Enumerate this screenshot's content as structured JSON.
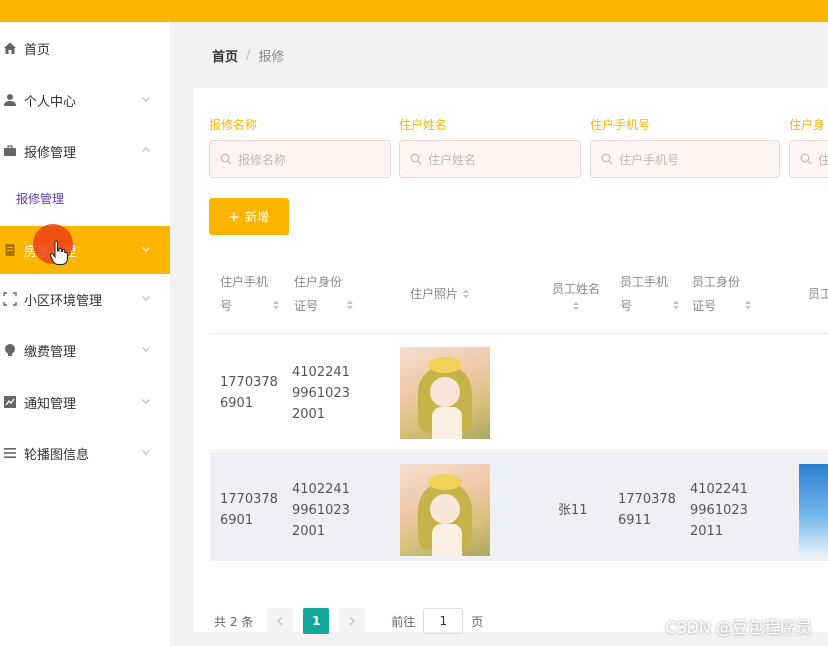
{
  "colors": {
    "accent": "#ffb400",
    "pager_active": "#13a89e",
    "submenu_text": "#5b3fa6"
  },
  "sidebar": {
    "items": [
      {
        "label": "首页",
        "icon": "home-icon"
      },
      {
        "label": "个人中心",
        "icon": "user-icon"
      },
      {
        "label": "报修管理",
        "icon": "briefcase-icon"
      },
      {
        "label": "房屋管理",
        "icon": "document-icon"
      },
      {
        "label": "小区环境管理",
        "icon": "scan-icon"
      },
      {
        "label": "缴费管理",
        "icon": "bulb-icon"
      },
      {
        "label": "通知管理",
        "icon": "chart-icon"
      },
      {
        "label": "轮播图信息",
        "icon": "list-icon"
      }
    ],
    "submenu": {
      "label": "报修管理"
    }
  },
  "breadcrumb": {
    "home": "首页",
    "separator": "/",
    "current": "报修"
  },
  "search": {
    "fields": [
      {
        "label": "报修名称",
        "placeholder": "报修名称"
      },
      {
        "label": "住户姓名",
        "placeholder": "住户姓名"
      },
      {
        "label": "住户手机号",
        "placeholder": "住户手机号"
      },
      {
        "label": "住户身",
        "placeholder": "住"
      }
    ]
  },
  "toolbar": {
    "add_label": "新增"
  },
  "table": {
    "headers": [
      "住户手机\n号",
      "住户身份\n证号",
      "住户照片",
      "员工姓名",
      "员工手机\n号",
      "员工身份\n证号",
      "员工"
    ],
    "rows": [
      {
        "phone": "1770378\n6901",
        "id_no": "4102241\n9961023\n2001",
        "staff_name": "",
        "staff_phone": "",
        "staff_id": "",
        "extra": ""
      },
      {
        "phone": "1770378\n6901",
        "id_no": "4102241\n9961023\n2001",
        "staff_name": "张11",
        "staff_phone": "1770378\n6911",
        "staff_id": "4102241\n9961023\n2011",
        "extra": ""
      }
    ]
  },
  "pager": {
    "total": "共 2 条",
    "current_page": "1",
    "goto_label": "前往",
    "goto_value": "1",
    "page_suffix": "页"
  },
  "watermark": "CSDN @豆包程序员"
}
